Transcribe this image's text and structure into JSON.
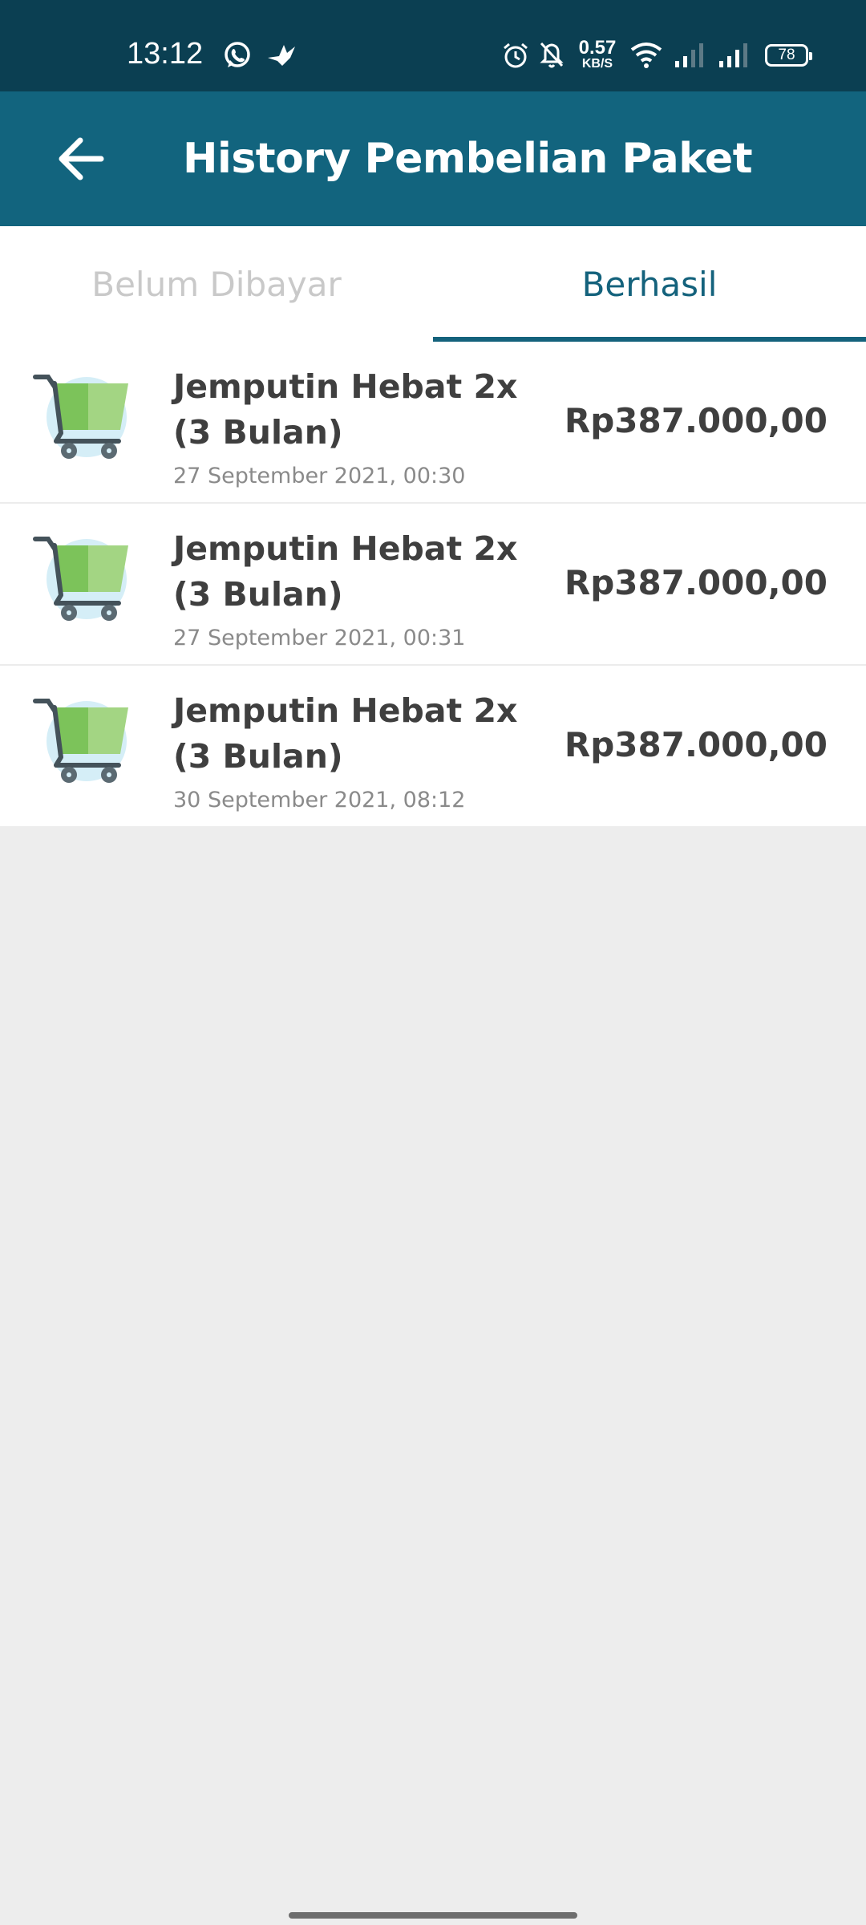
{
  "status_bar": {
    "time": "13:12",
    "speed_value": "0.57",
    "speed_unit": "KB/S",
    "battery": "78",
    "icons": [
      "whatsapp-icon",
      "bird-icon",
      "alarm-icon",
      "bell-off-icon",
      "wifi-icon",
      "signal-icon",
      "signal-icon",
      "battery-icon"
    ]
  },
  "app_bar": {
    "title": "History Pembelian Paket",
    "back_icon": "arrow-left-icon"
  },
  "tabs": [
    {
      "label": "Belum Dibayar",
      "active": false
    },
    {
      "label": "Berhasil",
      "active": true
    }
  ],
  "purchases": [
    {
      "title": "Jemputin Hebat 2x (3 Bulan)",
      "date": "27 September 2021, 00:30",
      "price": "Rp387.000,00",
      "icon": "shopping-cart-icon"
    },
    {
      "title": "Jemputin Hebat 2x (3 Bulan)",
      "date": "27 September 2021, 00:31",
      "price": "Rp387.000,00",
      "icon": "shopping-cart-icon"
    },
    {
      "title": "Jemputin Hebat 2x (3 Bulan)",
      "date": "30 September 2021, 08:12",
      "price": "Rp387.000,00",
      "icon": "shopping-cart-icon"
    }
  ],
  "colors": {
    "status_bar": "#0b3f52",
    "app_bar": "#12647e",
    "accent": "#14627c",
    "background": "#ededed"
  }
}
